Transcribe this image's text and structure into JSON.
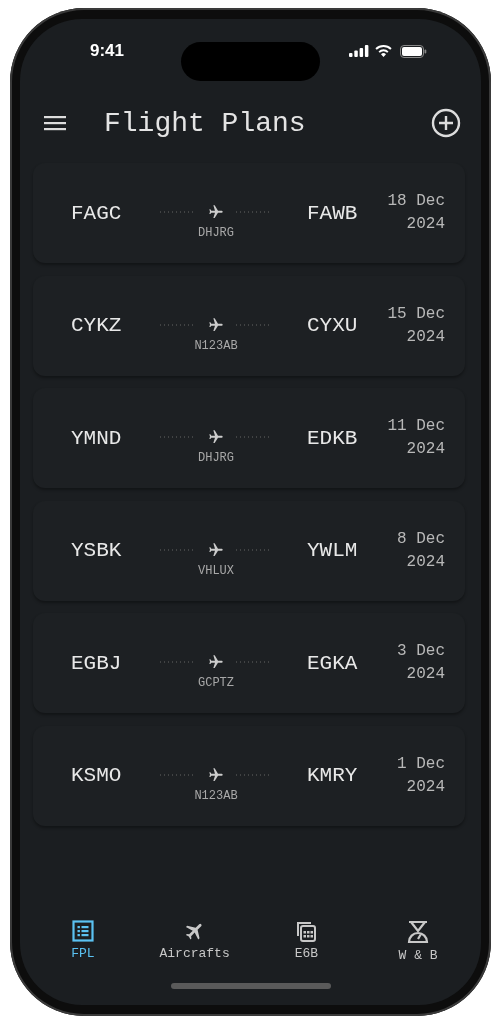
{
  "status_bar": {
    "time": "9:41"
  },
  "header": {
    "title": "Flight Plans"
  },
  "flights": [
    {
      "origin": "FAGC",
      "destination": "FAWB",
      "registration": "DHJRG",
      "date": "18 Dec 2024"
    },
    {
      "origin": "CYKZ",
      "destination": "CYXU",
      "registration": "N123AB",
      "date": "15 Dec 2024"
    },
    {
      "origin": "YMND",
      "destination": "EDKB",
      "registration": "DHJRG",
      "date": "11 Dec 2024"
    },
    {
      "origin": "YSBK",
      "destination": "YWLM",
      "registration": "VHLUX",
      "date": "8 Dec 2024"
    },
    {
      "origin": "EGBJ",
      "destination": "EGKA",
      "registration": "GCPTZ",
      "date": "3 Dec 2024"
    },
    {
      "origin": "KSMO",
      "destination": "KMRY",
      "registration": "N123AB",
      "date": "1 Dec 2024"
    }
  ],
  "tabs": [
    {
      "label": "FPL",
      "kind": "list",
      "selected": true
    },
    {
      "label": "Aircrafts",
      "kind": "plane",
      "selected": false
    },
    {
      "label": "E6B",
      "kind": "calculator",
      "selected": false
    },
    {
      "label": "W & B",
      "kind": "scale",
      "selected": false
    }
  ]
}
